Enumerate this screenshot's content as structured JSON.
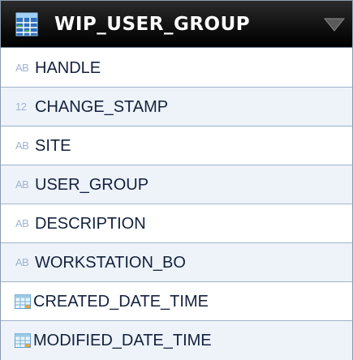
{
  "table": {
    "title": "WIP_USER_GROUP",
    "icon": "table-icon",
    "columns": [
      {
        "type": "AB",
        "type_icon": "text-type-icon",
        "name": "HANDLE"
      },
      {
        "type": "12",
        "type_icon": "number-type-icon",
        "name": "CHANGE_STAMP"
      },
      {
        "type": "AB",
        "type_icon": "text-type-icon",
        "name": "SITE"
      },
      {
        "type": "AB",
        "type_icon": "text-type-icon",
        "name": "USER_GROUP"
      },
      {
        "type": "AB",
        "type_icon": "text-type-icon",
        "name": "DESCRIPTION"
      },
      {
        "type": "AB",
        "type_icon": "text-type-icon",
        "name": "WORKSTATION_BO"
      },
      {
        "type": "",
        "type_icon": "datetime-type-icon",
        "name": "CREATED_DATE_TIME"
      },
      {
        "type": "",
        "type_icon": "datetime-type-icon",
        "name": "MODIFIED_DATE_TIME"
      }
    ]
  },
  "colors": {
    "header_bg": "#000000",
    "row_border": "#9eb3cc",
    "type_label": "#9fb4cf",
    "column_text": "#14213d"
  }
}
